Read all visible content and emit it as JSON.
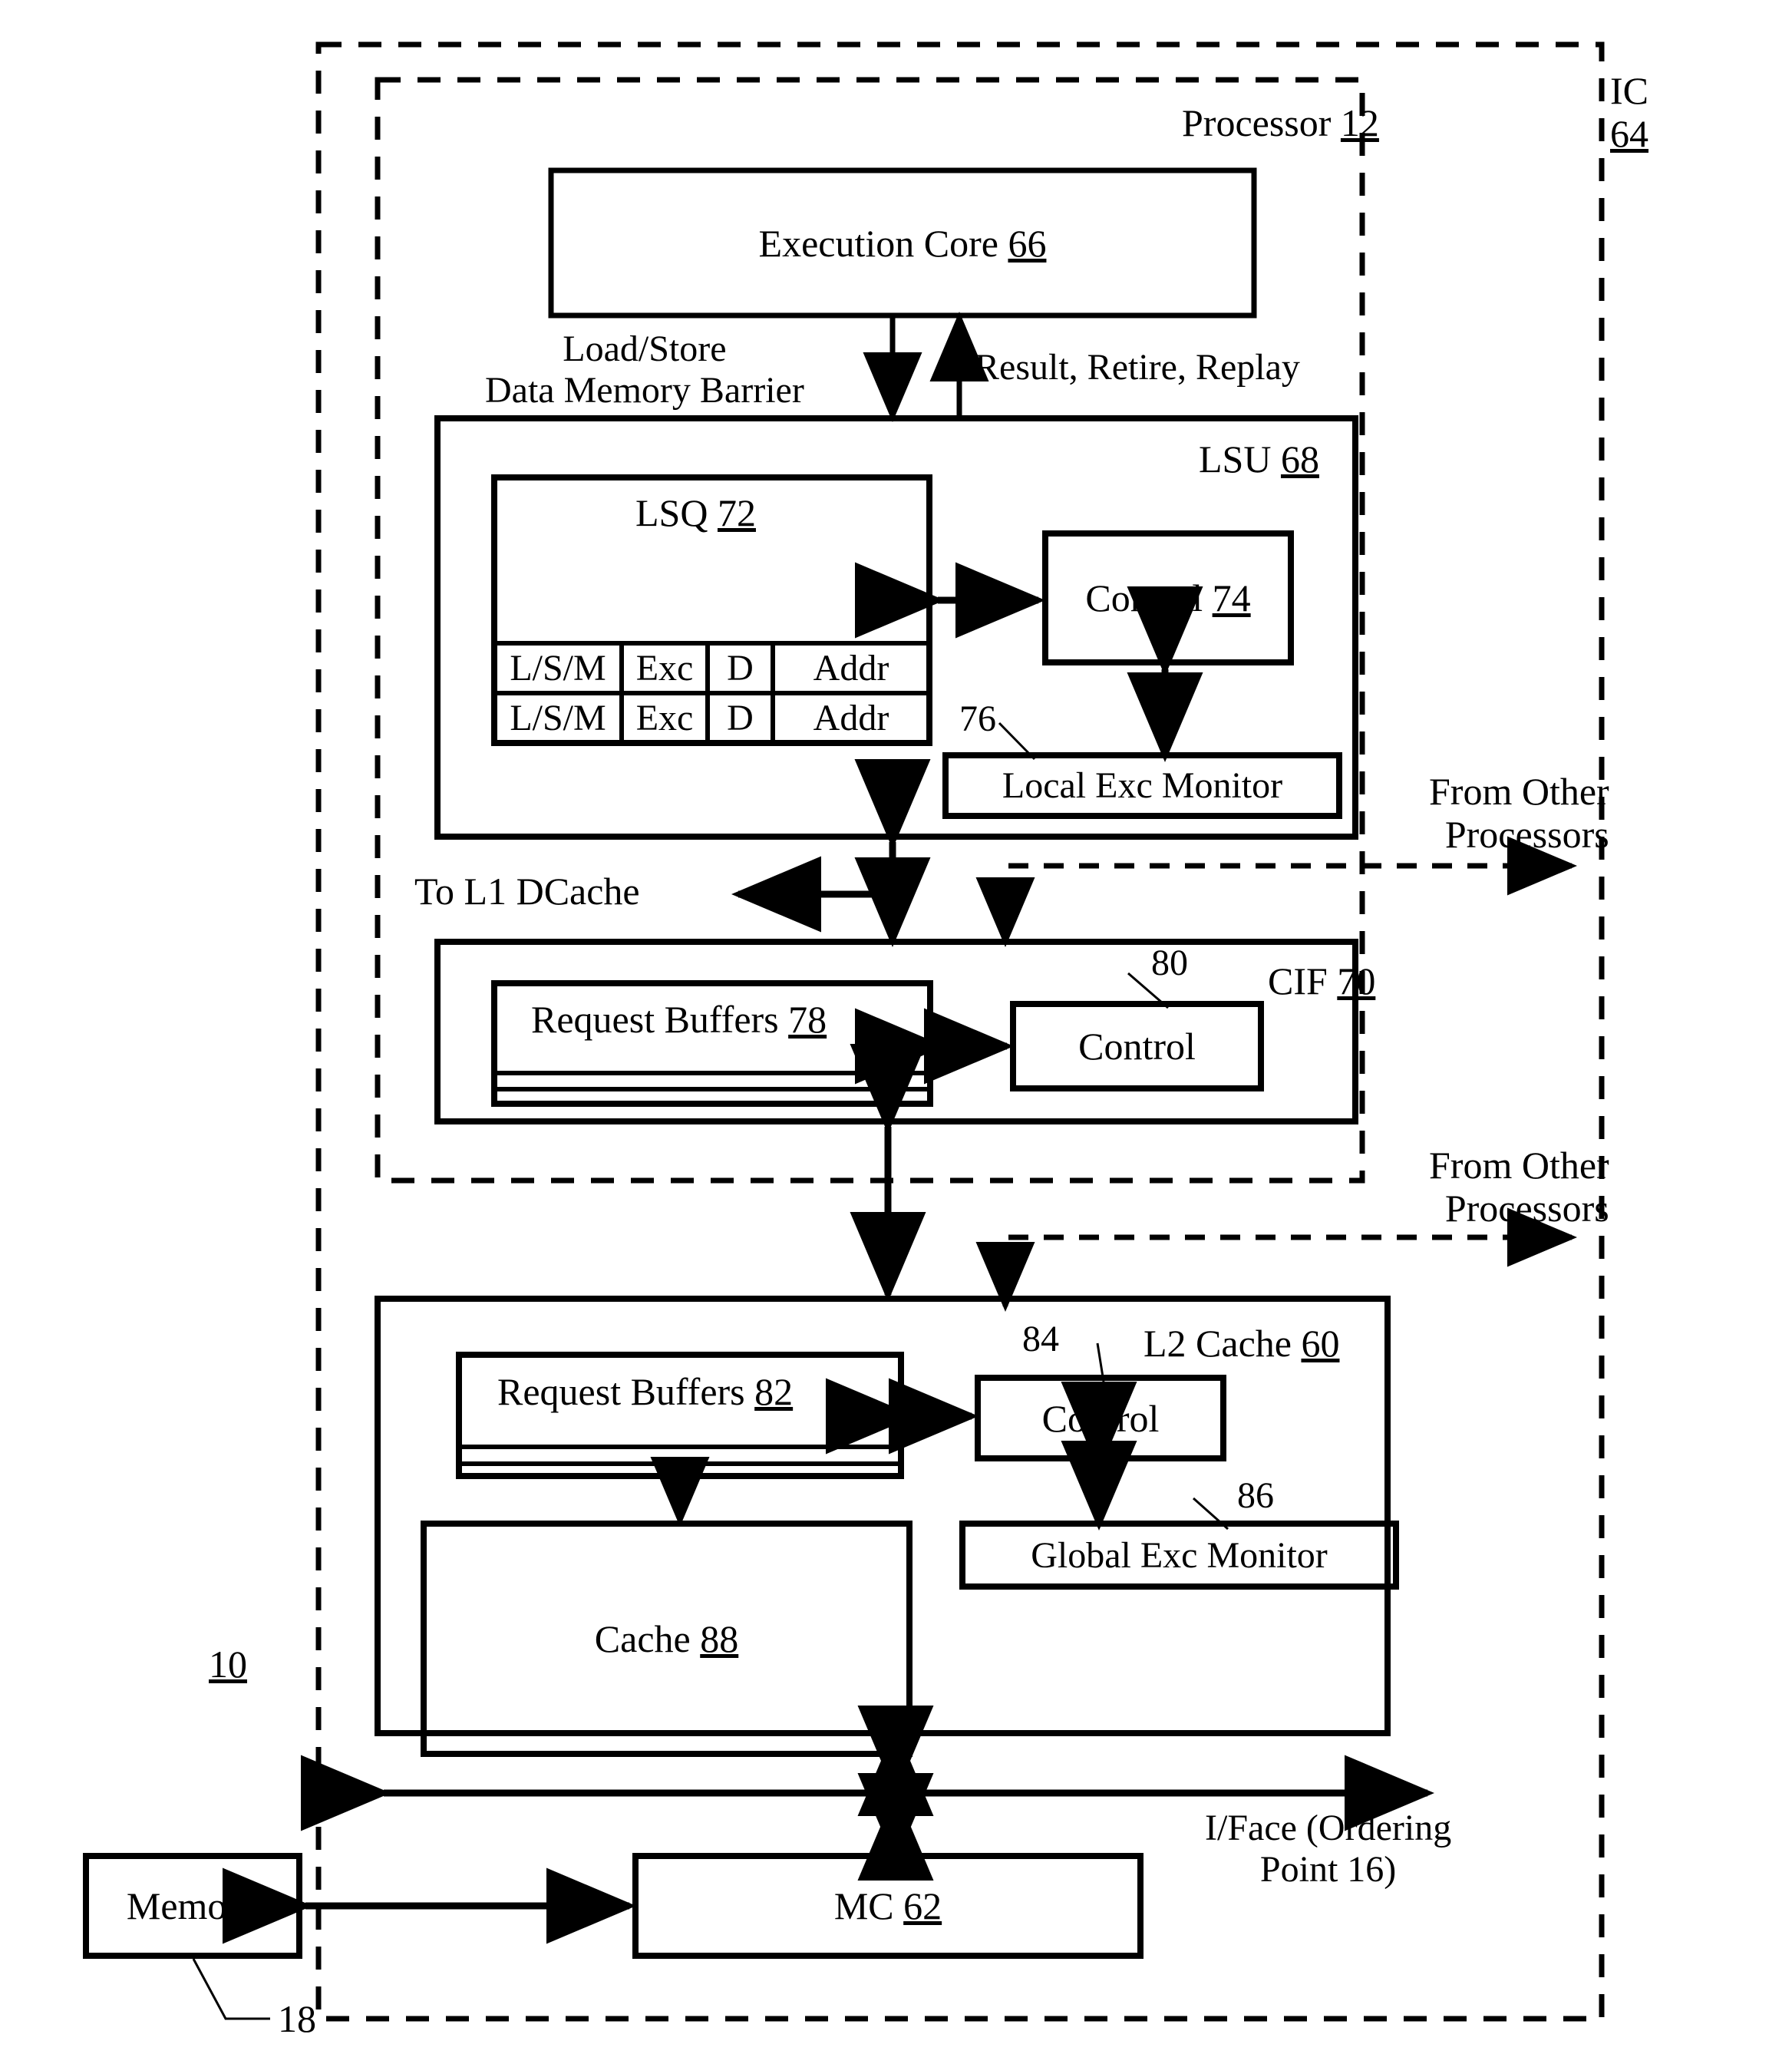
{
  "figure": {
    "type": "patent-block-diagram",
    "system_ref": "10",
    "ic": {
      "label": "IC",
      "ref": "64"
    },
    "processor": {
      "label": "Processor",
      "ref": "12"
    }
  },
  "blocks": {
    "execution_core": {
      "label": "Execution Core",
      "ref": "66"
    },
    "lsu": {
      "label": "LSU",
      "ref": "68"
    },
    "lsq": {
      "label": "LSQ",
      "ref": "72"
    },
    "lsu_control": {
      "label": "Control",
      "ref": "74"
    },
    "local_exc_monitor": {
      "label": "Local Exc Monitor",
      "ref": "76"
    },
    "cif": {
      "label": "CIF",
      "ref": "70"
    },
    "cif_request_buffers": {
      "label": "Request Buffers",
      "ref": "78"
    },
    "cif_control": {
      "label": "Control",
      "ref": "80"
    },
    "l2_cache": {
      "label": "L2 Cache",
      "ref": "60"
    },
    "l2_request_buffers": {
      "label": "Request Buffers",
      "ref": "82"
    },
    "l2_control": {
      "label": "Control",
      "ref": "84"
    },
    "global_exc_monitor": {
      "label": "Global Exc Monitor",
      "ref": "86"
    },
    "cache": {
      "label": "Cache",
      "ref": "88"
    },
    "mc": {
      "label": "MC",
      "ref": "62"
    },
    "memory": {
      "label": "Memory",
      "ref": "18"
    }
  },
  "lsq_table": {
    "columns": [
      "L/S/M",
      "Exc",
      "D",
      "Addr"
    ],
    "rows": [
      [
        "L/S/M",
        "Exc",
        "D",
        "Addr"
      ],
      [
        "L/S/M",
        "Exc",
        "D",
        "Addr"
      ]
    ]
  },
  "edge_labels": {
    "load_store_line1": "Load/Store",
    "load_store_line2": "Data Memory Barrier",
    "result_retire_replay": "Result, Retire, Replay",
    "to_l1_dcache": "To L1 DCache",
    "from_other_processors_1_line1": "From Other",
    "from_other_processors_1_line2": "Processors",
    "from_other_processors_2_line1": "From Other",
    "from_other_processors_2_line2": "Processors",
    "iface_line1": "I/Face (Ordering",
    "iface_line2": "Point 16)"
  },
  "refs": {
    "local_exc_monitor_lead": "76",
    "cif_control_lead": "80",
    "l2_control_lead": "84",
    "global_exc_monitor_lead": "86",
    "memory_lead": "18",
    "system": "10"
  },
  "colors": {
    "stroke": "#000000",
    "background": "#ffffff"
  }
}
